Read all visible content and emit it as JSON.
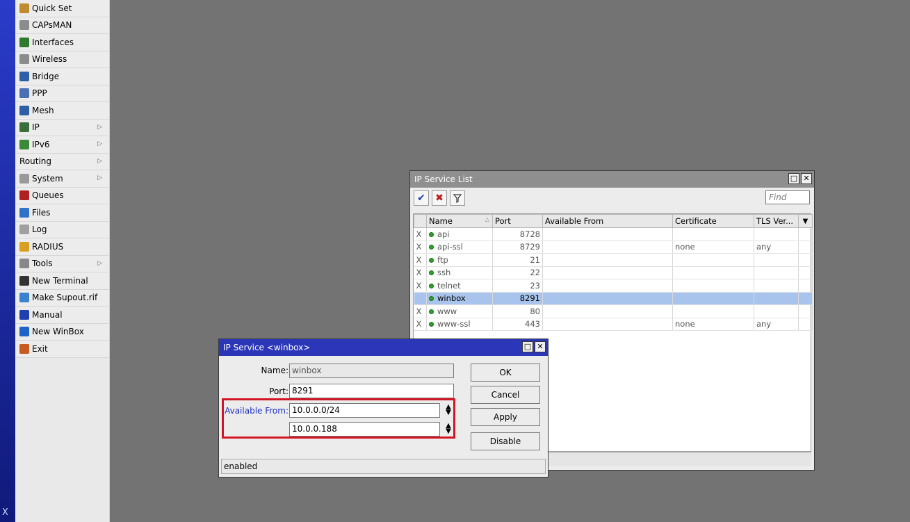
{
  "vertical_text": "X",
  "sidebar": {
    "items": [
      {
        "label": "Quick Set",
        "icon": "wrench-icon",
        "color": "#c08a2e",
        "submenu": false
      },
      {
        "label": "CAPsMAN",
        "icon": "antenna-icon",
        "color": "#8c8c8c",
        "submenu": false
      },
      {
        "label": "Interfaces",
        "icon": "interfaces-icon",
        "color": "#2f7a2f",
        "submenu": false
      },
      {
        "label": "Wireless",
        "icon": "wireless-icon",
        "color": "#8c8c8c",
        "submenu": false
      },
      {
        "label": "Bridge",
        "icon": "bridge-icon",
        "color": "#2e5fa8",
        "submenu": false
      },
      {
        "label": "PPP",
        "icon": "ppp-icon",
        "color": "#4a6fb5",
        "submenu": false
      },
      {
        "label": "Mesh",
        "icon": "mesh-icon",
        "color": "#2e5fa8",
        "submenu": false
      },
      {
        "label": "IP",
        "icon": "ip-icon",
        "color": "#3a6e3a",
        "submenu": true
      },
      {
        "label": "IPv6",
        "icon": "ipv6-icon",
        "color": "#3a8a3a",
        "submenu": true
      },
      {
        "label": "Routing",
        "icon": "",
        "color": "",
        "submenu": true
      },
      {
        "label": "System",
        "icon": "system-icon",
        "color": "#9a9a9a",
        "submenu": true
      },
      {
        "label": "Queues",
        "icon": "queues-icon",
        "color": "#b02020",
        "submenu": false
      },
      {
        "label": "Files",
        "icon": "files-icon",
        "color": "#2f72c8",
        "submenu": false
      },
      {
        "label": "Log",
        "icon": "log-icon",
        "color": "#a0a0a0",
        "submenu": false
      },
      {
        "label": "RADIUS",
        "icon": "radius-icon",
        "color": "#d8a020",
        "submenu": false
      },
      {
        "label": "Tools",
        "icon": "tools-icon",
        "color": "#888888",
        "submenu": true
      },
      {
        "label": "New Terminal",
        "icon": "terminal-icon",
        "color": "#333333",
        "submenu": false
      },
      {
        "label": "Make Supout.rif",
        "icon": "supout-icon",
        "color": "#3a82d0",
        "submenu": false
      },
      {
        "label": "Manual",
        "icon": "manual-icon",
        "color": "#2040b0",
        "submenu": false
      },
      {
        "label": "New WinBox",
        "icon": "winbox-icon",
        "color": "#1e64c8",
        "submenu": false
      },
      {
        "label": "Exit",
        "icon": "exit-icon",
        "color": "#c85a20",
        "submenu": false
      }
    ]
  },
  "service_list": {
    "title": "IP Service List",
    "find_placeholder": "Find",
    "columns": [
      "Name",
      "Port",
      "Available From",
      "Certificate",
      "TLS Ver..."
    ],
    "rows": [
      {
        "flag": "X",
        "name": "api",
        "port": "8728",
        "available_from": "",
        "certificate": "",
        "tls": "",
        "selected": false
      },
      {
        "flag": "X",
        "name": "api-ssl",
        "port": "8729",
        "available_from": "",
        "certificate": "none",
        "tls": "any",
        "selected": false
      },
      {
        "flag": "X",
        "name": "ftp",
        "port": "21",
        "available_from": "",
        "certificate": "",
        "tls": "",
        "selected": false
      },
      {
        "flag": "X",
        "name": "ssh",
        "port": "22",
        "available_from": "",
        "certificate": "",
        "tls": "",
        "selected": false
      },
      {
        "flag": "X",
        "name": "telnet",
        "port": "23",
        "available_from": "",
        "certificate": "",
        "tls": "",
        "selected": false
      },
      {
        "flag": "",
        "name": "winbox",
        "port": "8291",
        "available_from": "",
        "certificate": "",
        "tls": "",
        "selected": true
      },
      {
        "flag": "X",
        "name": "www",
        "port": "80",
        "available_from": "",
        "certificate": "",
        "tls": "",
        "selected": false
      },
      {
        "flag": "X",
        "name": "www-ssl",
        "port": "443",
        "available_from": "",
        "certificate": "none",
        "tls": "any",
        "selected": false
      }
    ]
  },
  "service_dialog": {
    "title": "IP Service <winbox>",
    "name_label": "Name:",
    "name_value": "winbox",
    "port_label": "Port:",
    "port_value": "8291",
    "available_label": "Available From:",
    "available_values": [
      "10.0.0.0/24",
      "10.0.0.188"
    ],
    "buttons": {
      "ok": "OK",
      "cancel": "Cancel",
      "apply": "Apply",
      "disable": "Disable"
    },
    "status": "enabled"
  },
  "colors": {
    "title_active": "#2b36b8",
    "title_inactive": "#8f8f8f",
    "highlight": "#d31623",
    "selected_row": "#a8c4ec"
  }
}
